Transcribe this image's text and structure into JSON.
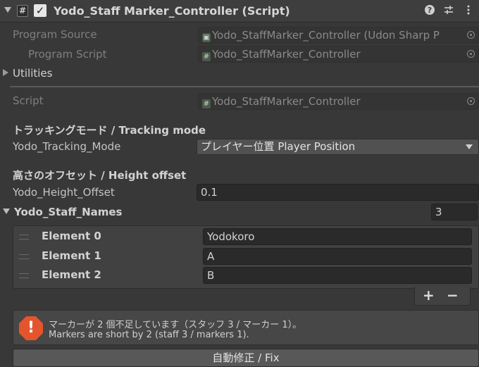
{
  "header": {
    "title": "Yodo_Staff Marker_Controller (Script)",
    "enabled": true,
    "script_icon_glyph": "#",
    "icons": [
      "script-icon",
      "enable-checkbox",
      "help-icon",
      "presets-icon",
      "kebab-menu-icon"
    ]
  },
  "program_source": {
    "label": "Program Source",
    "value": "Yodo_StaffMarker_Controller (Udon Sharp P"
  },
  "program_script": {
    "label": "Program Script",
    "value": "Yodo_StaffMarker_Controller"
  },
  "utilities": {
    "label": "Utilities"
  },
  "script": {
    "label": "Script",
    "value": "Yodo_StaffMarker_Controller"
  },
  "tracking": {
    "section": "トラッキングモード / Tracking mode",
    "label": "Yodo_Tracking_Mode",
    "value": "プレイヤー位置 Player Position"
  },
  "height": {
    "section": "高さのオフセット / Height offset",
    "label": "Yodo_Height_Offset",
    "value": "0.1"
  },
  "staff_names": {
    "label": "Yodo_Staff_Names",
    "size": "3",
    "elements": [
      {
        "label": "Element 0",
        "value": "Yodokoro"
      },
      {
        "label": "Element 1",
        "value": "A"
      },
      {
        "label": "Element 2",
        "value": "B"
      }
    ],
    "add": "+",
    "remove": "−"
  },
  "warning": {
    "line1": "マーカーが 2 個不足しています（スタッフ 3 / マーカー 1）。",
    "line2": "Markers are short by 2 (staff 3 / markers 1).",
    "icon_glyph": "!"
  },
  "fix_button": {
    "label": "自動修正 / Fix"
  },
  "colors": {
    "background": "#383838",
    "warning": "#e4552d",
    "field": "#2a2a2a"
  }
}
